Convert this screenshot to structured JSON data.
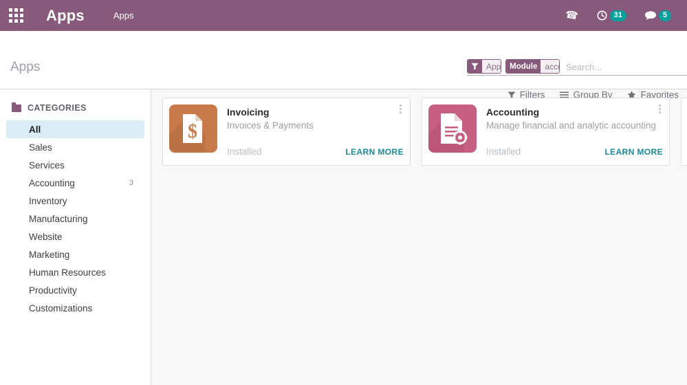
{
  "navbar": {
    "apps_menu_icon": "grid-icon",
    "brand": "Apps",
    "breadcrumb": "Apps",
    "phone_icon": "phone-icon",
    "activity_icon": "clock-icon",
    "activity_count": "31",
    "messaging_icon": "chat-bubble-icon",
    "messaging_count": "5",
    "brand_color": "#875A7B",
    "badge_color": "#00A09D"
  },
  "control_panel": {
    "page_title": "Apps",
    "search": {
      "placeholder": "Search...",
      "value": "",
      "facets": [
        {
          "icon": "filter-funnel-icon",
          "label": "",
          "value": "Apps",
          "remove": "✖"
        },
        {
          "icon": "",
          "label": "Module",
          "value": "account",
          "remove": "✖"
        }
      ]
    },
    "buttons": [
      {
        "icon": "filter-funnel-icon",
        "label": "Filters"
      },
      {
        "icon": "list-lines-icon",
        "label": "Group By"
      },
      {
        "icon": "star-icon",
        "label": "Favorites"
      }
    ]
  },
  "sidebar": {
    "header": {
      "icon": "folder-icon",
      "label": "CATEGORIES"
    },
    "items": [
      {
        "label": "All",
        "count": "",
        "selected": true
      },
      {
        "label": "Sales",
        "count": "",
        "selected": false
      },
      {
        "label": "Services",
        "count": "",
        "selected": false
      },
      {
        "label": "Accounting",
        "count": "3",
        "selected": false
      },
      {
        "label": "Inventory",
        "count": "",
        "selected": false
      },
      {
        "label": "Manufacturing",
        "count": "",
        "selected": false
      },
      {
        "label": "Website",
        "count": "",
        "selected": false
      },
      {
        "label": "Marketing",
        "count": "",
        "selected": false
      },
      {
        "label": "Human Resources",
        "count": "",
        "selected": false
      },
      {
        "label": "Productivity",
        "count": "",
        "selected": false
      },
      {
        "label": "Customizations",
        "count": "",
        "selected": false
      }
    ]
  },
  "apps": [
    {
      "name": "Invoicing",
      "summary": "Invoices & Payments",
      "state": "Installed",
      "action": "LEARN MORE",
      "icon": "invoice-dollar-document-icon",
      "icon_color": "#C77B4A",
      "icon_color_dark": "#A8663C",
      "menu_icon": "kebab-menu-icon"
    },
    {
      "name": "Accounting",
      "summary": "Manage financial and analytic accounting",
      "state": "Installed",
      "action": "LEARN MORE",
      "icon": "document-gear-icon",
      "icon_color": "#C75F82",
      "icon_color_dark": "#A94E6D",
      "menu_icon": "kebab-menu-icon"
    }
  ]
}
